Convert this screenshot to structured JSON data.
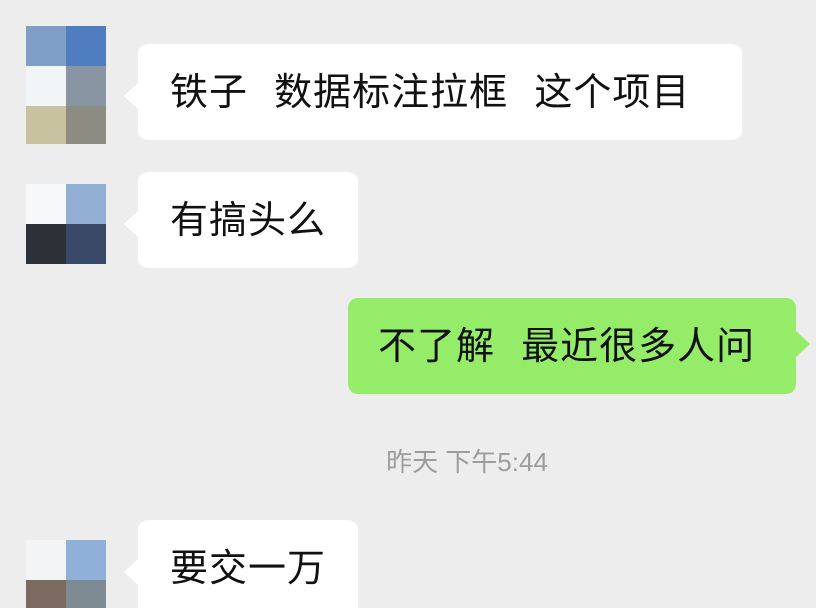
{
  "colors": {
    "background": "#ededed",
    "incoming_bubble": "#ffffff",
    "outgoing_bubble": "#95ec69",
    "timestamp_text": "#9d9d9d"
  },
  "messages": [
    {
      "direction": "incoming",
      "text": "铁子  数据标注拉框  这个项目",
      "avatar": "pixelated-avatar"
    },
    {
      "direction": "incoming",
      "text": "有搞头么",
      "avatar": "pixelated-avatar"
    },
    {
      "direction": "outgoing",
      "text": "不了解  最近很多人问"
    },
    {
      "direction": "incoming",
      "text": "要交一万",
      "avatar": "pixelated-avatar"
    }
  ],
  "timestamp": "昨天 下午5:44"
}
